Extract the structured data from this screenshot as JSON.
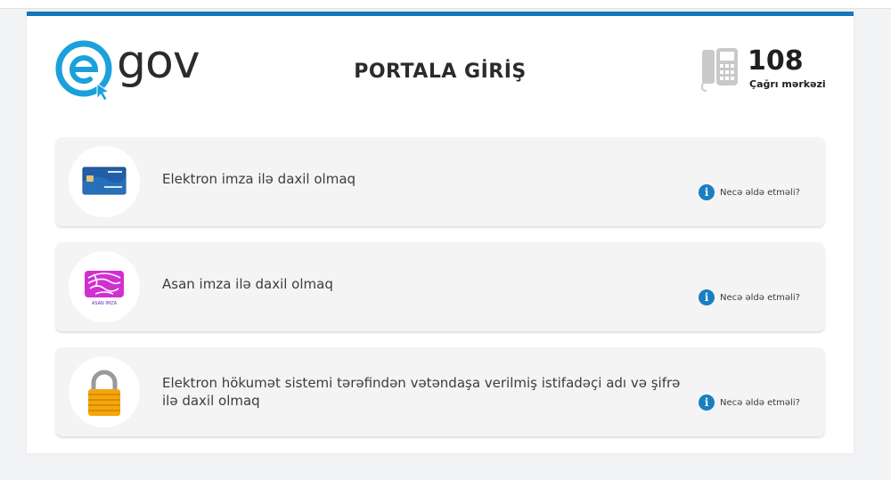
{
  "header": {
    "logo_text": "gov",
    "title": "PORTALA GİRİŞ",
    "call_center": {
      "number": "108",
      "label": "Çağrı mərkəzi"
    }
  },
  "options": [
    {
      "label": "Elektron imza ilə daxil olmaq",
      "help": "Necə əldə etməli?",
      "icon": "smart-card-icon"
    },
    {
      "label": "Asan imza ilə daxil olmaq",
      "help": "Necə əldə etməli?",
      "icon": "asan-imza-icon",
      "icon_text": "ASAN İMZA"
    },
    {
      "label": "Elektron hökumət sistemi tərəfindən vətəndaşa verilmiş istifadəçi adı və şifrə ilə daxil olmaq",
      "help": "Necə əldə etməli?",
      "icon": "lock-icon"
    }
  ],
  "colors": {
    "accent": "#1676bc",
    "logo_blue": "#1aa1db",
    "info": "#1a7fc1",
    "asan_pink": "#d12fd1",
    "lock_gold": "#f4a60a"
  }
}
